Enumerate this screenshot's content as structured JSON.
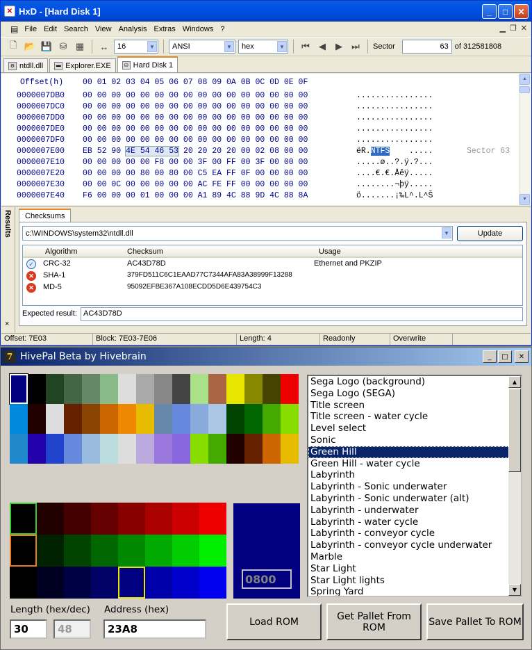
{
  "hxd": {
    "title": "HxD - [Hard Disk 1]",
    "menu": [
      "File",
      "Edit",
      "Search",
      "View",
      "Analysis",
      "Extras",
      "Windows",
      "?"
    ],
    "toolbar": {
      "bytes_per_row": "16",
      "charset": "ANSI",
      "base": "hex",
      "sector_label": "Sector",
      "sector_value": "63",
      "sector_of": "of 312581808"
    },
    "tabs": [
      "ntdll.dll",
      "Explorer.EXE",
      "Hard Disk 1"
    ],
    "header": {
      "offset": "Offset(h)",
      "cols": "00 01 02 03 04 05 06 07 08 09 0A 0B 0C 0D 0E 0F"
    },
    "rows": [
      {
        "off": "0000007DB0",
        "bytes": "00 00 00 00 00 00 00 00 00 00 00 00 00 00 00 00",
        "asc": "................"
      },
      {
        "off": "0000007DC0",
        "bytes": "00 00 00 00 00 00 00 00 00 00 00 00 00 00 00 00",
        "asc": "................"
      },
      {
        "off": "0000007DD0",
        "bytes": "00 00 00 00 00 00 00 00 00 00 00 00 00 00 00 00",
        "asc": "................"
      },
      {
        "off": "0000007DE0",
        "bytes": "00 00 00 00 00 00 00 00 00 00 00 00 00 00 00 00",
        "asc": "................"
      },
      {
        "off": "0000007DF0",
        "bytes": "00 00 00 00 00 00 00 00 00 00 00 00 00 00 00 00",
        "asc": "................"
      },
      {
        "off": "0000007E00",
        "b_pre": "EB 52 90 ",
        "b_sel": "4E 54 46 53",
        "b_post": " 20 20 20 20 00 02 08 00 00",
        "a_pre": "ëR.",
        "a_sel": "NTFS",
        "a_post": "    .....",
        "sector": "Sector 63"
      },
      {
        "off": "0000007E10",
        "bytes": "00 00 00 00 00 F8 00 00 3F 00 FF 00 3F 00 00 00",
        "asc": ".....ø..?.ÿ.?..."
      },
      {
        "off": "0000007E20",
        "bytes": "00 00 00 00 80 00 80 00 C5 EA FF 0F 00 00 00 00",
        "asc": "....€.€.Åêÿ....."
      },
      {
        "off": "0000007E30",
        "bytes": "00 00 0C 00 00 00 00 00 AC FE FF 00 00 00 00 00",
        "asc": "........¬þÿ....."
      },
      {
        "off": "0000007E40",
        "bytes": "F6 00 00 00 01 00 00 00 A1 89 4C 88 9D 4C 88 8A",
        "asc": "ö.......¡‰L^.L^Š"
      }
    ],
    "results_label": "Results",
    "results_close": "×",
    "checksums_tab": "Checksums",
    "file": "c:\\WINDOWS\\system32\\ntdll.dll",
    "update": "Update",
    "columns": [
      "Algorithm",
      "Checksum",
      "Usage"
    ],
    "checks": [
      {
        "alg": "CRC-32",
        "sum": "AC43D78D",
        "usage": "Ethernet and PKZIP",
        "ok": "✓"
      },
      {
        "alg": "SHA-1",
        "sum": "379FD511C6C1EAAD77C7344AFA83A38999F13288",
        "usage": "",
        "ok": "✕"
      },
      {
        "alg": "MD-5",
        "sum": "95092EFBE367A108ECDD5D6E439754C3",
        "usage": "",
        "ok": "✕"
      }
    ],
    "expected_label": "Expected result:",
    "expected_value": "AC43D78D",
    "status": [
      "Offset: 7E03",
      "Block: 7E03-7E06",
      "Length: 4",
      "Readonly",
      "Overwrite"
    ]
  },
  "hivepal": {
    "title": "HivePal Beta by Hivebrain",
    "logo": "7",
    "palette_rows": [
      [
        "#000080",
        "#000000",
        "#224422",
        "#446644",
        "#668866",
        "#88bb88",
        "#dddddd",
        "#aaaaaa",
        "#888888",
        "#444444",
        "#aae088",
        "#aa6644",
        "#e6e600",
        "#888800",
        "#444400",
        "#ee0000"
      ],
      [
        "#0088dd",
        "#220000",
        "#dddddd",
        "#662200",
        "#884400",
        "#cc6600",
        "#ee8800",
        "#e6bb00",
        "#6688aa",
        "#6688dd",
        "#88aadd",
        "#aac8e6",
        "#004400",
        "#006600",
        "#44aa00",
        "#88dd00"
      ],
      [
        "#2288cc",
        "#2200aa",
        "#2244cc",
        "#6688dd",
        "#99bbdd",
        "#bbdddd",
        "#dddddd",
        "#bbaadd",
        "#9977dd",
        "#8866dd",
        "#88dd00",
        "#44aa00",
        "#220000",
        "#662200",
        "#cc6600",
        "#e6bb00"
      ]
    ],
    "red_row": [
      "#000000",
      "#220000",
      "#440000",
      "#660000",
      "#880000",
      "#aa0000",
      "#cc0000",
      "#ee0000"
    ],
    "green_row": [
      "#000000",
      "#002200",
      "#004400",
      "#006600",
      "#008800",
      "#00aa00",
      "#00cc00",
      "#00ee00"
    ],
    "blue_row": [
      "#000000",
      "#000022",
      "#000044",
      "#000066",
      "#000080",
      "#0000aa",
      "#0000cc",
      "#0000ee"
    ],
    "color_hex": "0800",
    "list": [
      "Sega Logo (background)",
      "Sega Logo (SEGA)",
      "Title screen",
      "Title screen - water cycle",
      "Level select",
      "Sonic",
      "Green Hill",
      "Green Hill - water cycle",
      "Labyrinth",
      "Labyrinth - Sonic underwater",
      "Labyrinth - Sonic underwater (alt)",
      "Labyrinth - underwater",
      "Labyrinth - water cycle",
      "Labyrinth - conveyor cycle",
      "Labyrinth - conveyor cycle underwater",
      "Marble",
      "Star Light",
      "Star Light lights",
      "Spring Yard"
    ],
    "selected": 6,
    "length_label": "Length (hex/dec)",
    "length_hex": "30",
    "length_dec": "48",
    "address_label": "Address (hex)",
    "address": "23A8",
    "buttons": [
      "Load ROM",
      "Get Pallet From ROM",
      "Save Pallet To ROM"
    ]
  }
}
